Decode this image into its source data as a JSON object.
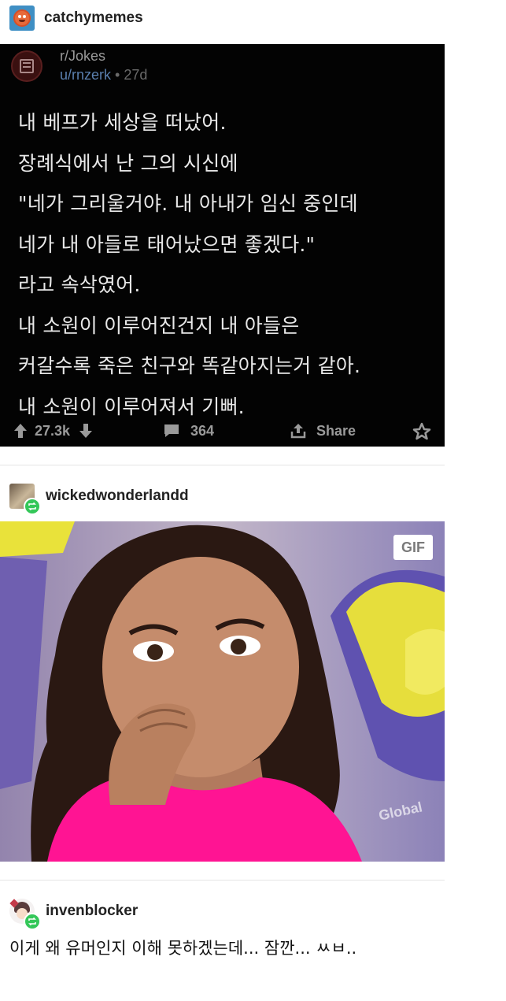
{
  "posts": [
    {
      "username": "catchymemes",
      "reddit": {
        "subreddit": "r/Jokes",
        "user": "u/rnzerk",
        "age": "27d",
        "lines": [
          "내 베프가 세상을 떠났어.",
          "장례식에서 난 그의 시신에",
          "\"네가 그리울거야. 내 아내가 임신 중인데",
          "네가 내 아들로 태어났으면 좋겠다.\"",
          "라고 속삭였어.",
          "내 소원이 이루어진건지 내 아들은",
          "커갈수록 죽은 친구와 똑같아지는거 같아.",
          "내 소원이 이루어져서 기뻐."
        ],
        "upvotes": "27.3k",
        "comments": "364",
        "share_label": "Share"
      }
    },
    {
      "username": "wickedwonderlandd",
      "gif_badge": "GIF",
      "watermark": "Global"
    },
    {
      "username": "invenblocker",
      "comment": "이게 왜 유머인지 이해 못하겠는데... 잠깐... ㅆㅂ.."
    }
  ],
  "icons": {
    "upvote": "arrow-up-icon",
    "downvote": "arrow-down-icon",
    "comments": "comment-icon",
    "share": "share-icon",
    "award": "award-icon",
    "reblog": "reblog-icon"
  },
  "colors": {
    "card_bg": "#030303",
    "post_text": "#e8e8e8",
    "meta_text": "#9a9a9a",
    "user_link": "#5a7fae",
    "reblog_green": "#34c759",
    "shirt_pink": "#ff1493",
    "seat_yellow": "#e9e23a"
  }
}
